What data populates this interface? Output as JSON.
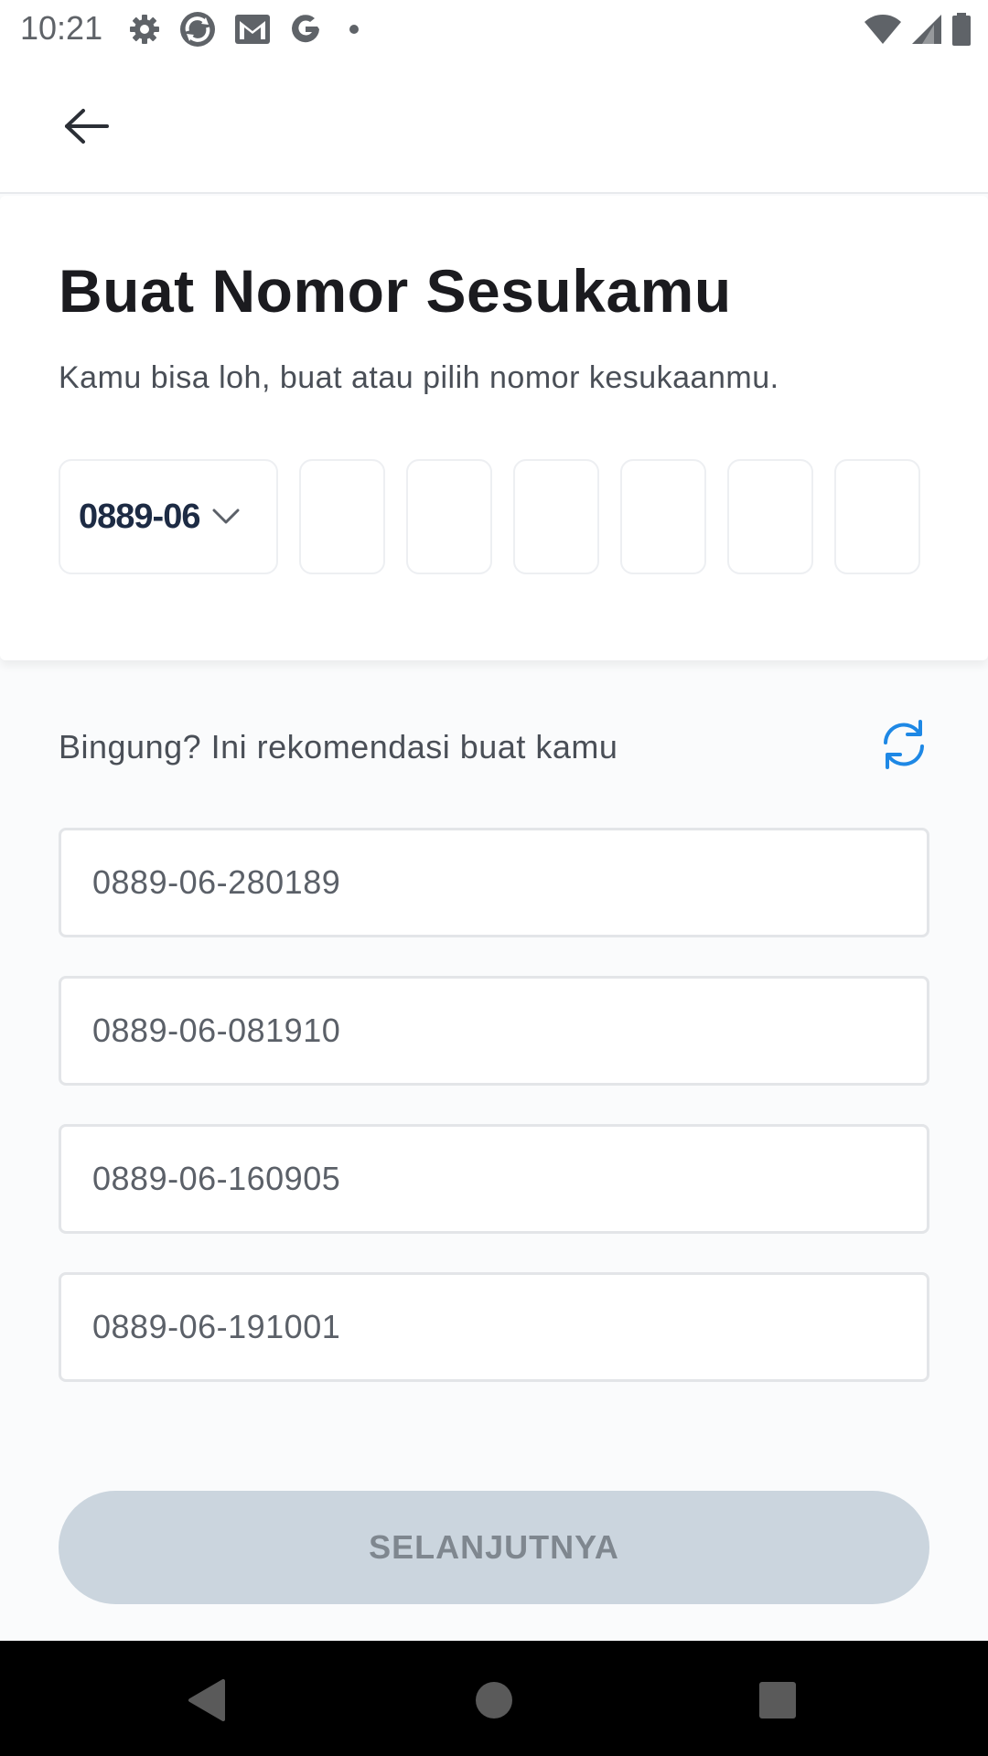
{
  "status_bar": {
    "time": "10:21",
    "left_icons": [
      "settings-icon",
      "sync-app-icon",
      "gmail-icon",
      "google-icon",
      "notification-dot-icon"
    ],
    "right_icons": [
      "wifi-icon",
      "signal-icon",
      "battery-icon"
    ]
  },
  "header": {
    "back_icon": "arrow-left-icon"
  },
  "main": {
    "title": "Buat Nomor Sesukamu",
    "subtitle": "Kamu bisa loh, buat atau pilih nomor kesukaanmu.",
    "prefix_select": {
      "value": "0889-06",
      "icon": "chevron-down-icon"
    },
    "digit_inputs": [
      "",
      "",
      "",
      "",
      "",
      ""
    ]
  },
  "recommendations": {
    "label": "Bingung? Ini rekomendasi buat kamu",
    "refresh_icon": "refresh-icon",
    "items": [
      "0889-06-280189",
      "0889-06-081910",
      "0889-06-160905",
      "0889-06-191001"
    ]
  },
  "footer": {
    "next_label": "SELANJUTNYA"
  },
  "nav_bar": {
    "icons": [
      "back-triangle-icon",
      "home-circle-icon",
      "recents-square-icon"
    ]
  },
  "colors": {
    "accent": "#1e88e5",
    "title": "#1b1b1f",
    "button_disabled_bg": "#cbd5de",
    "button_disabled_text": "#7f878f"
  }
}
